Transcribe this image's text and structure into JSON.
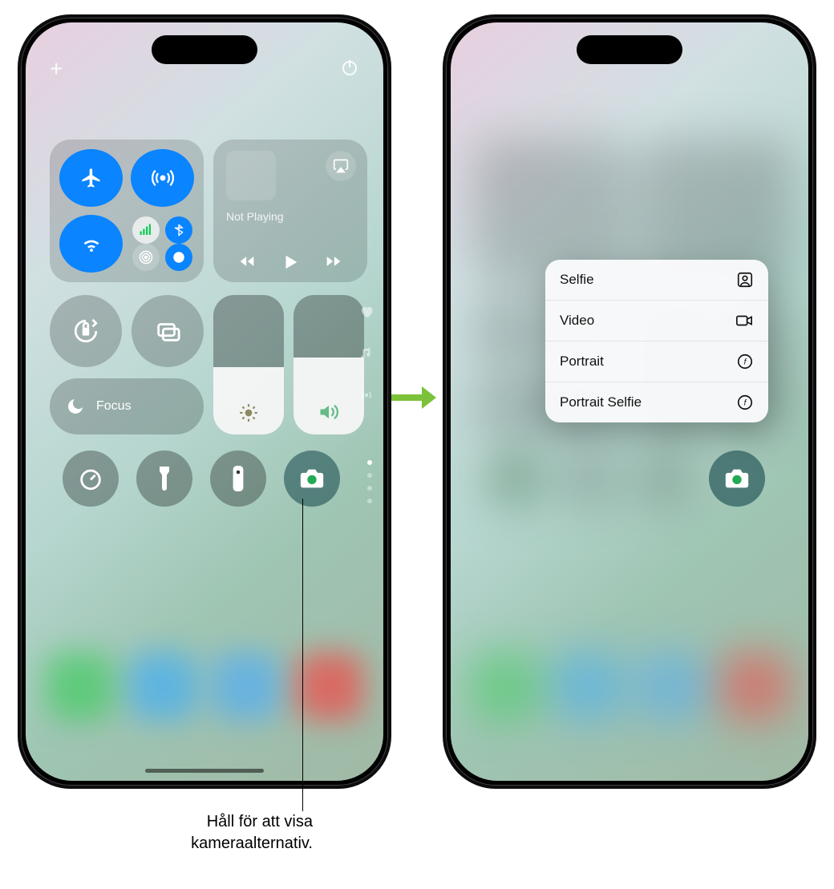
{
  "left_phone": {
    "top": {
      "add": "+"
    },
    "media": {
      "title": "Not Playing"
    },
    "focus": {
      "label": "Focus"
    }
  },
  "right_phone": {
    "menu": {
      "items": [
        {
          "label": "Selfie",
          "icon": "person-square-icon"
        },
        {
          "label": "Video",
          "icon": "video-icon"
        },
        {
          "label": "Portrait",
          "icon": "aperture-f-icon"
        },
        {
          "label": "Portrait Selfie",
          "icon": "aperture-f-icon"
        }
      ]
    }
  },
  "callout": {
    "text_line1": "Håll för att visa",
    "text_line2": "kameraalternativ."
  }
}
